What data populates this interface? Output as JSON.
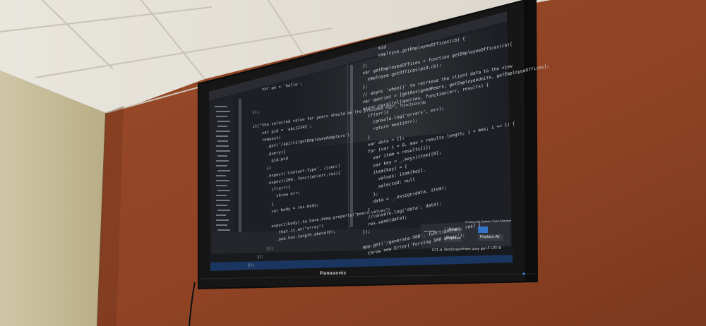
{
  "tv": {
    "brand": "Panasonic"
  },
  "editor": {
    "left_code": [
      "        var po = 'hello';",
      "",
      "        ",
      "    });",
      "",
      "    it(\"the selected value for peers should be the provided PID\", function(do",
      "        var pid = 'abc12345';",
      "        request(",
      "          .get('/api/v1/getEmployeeAdapters')",
      "          .query({",
      "            pid:pid",
      "          })",
      "          .expect('Content-Type', /json/)",
      "          .expect(200, function(err,res){",
      "            if(err){",
      "              throw err;",
      "            }",
      "            var body = res.body;",
      "",
      "            expect(body).to.have.deep.property(\"peers.values\")",
      "              .that.is.an(\"array\")",
      "              .and.has.length.above(0);",
      "          });",
      "      });",
      "  });"
    ],
    "right_code": [
      "        mid",
      "        employee.getEmployeeOffices(cb) {",
      "  };",
      "  var getEmployeeOffices = function getEmployeeOffices(cb){",
      "    employee.getOffices(pid,cb);",
      "  };",
      "  // async 'when()' to retrieve the client data to the view",
      "  var queries = [getAssignedPeers, getEmployeeUnits, getEmployeeOffices];",
      "  async.parallel(queries, function(err, results) {",
      "    if(err){",
      "      console.log('errors', err);",
      "      return next(err);",
      "    }",
      "    var data = {};",
      "    for (var i = 0, max = results.length; i < max; i += 1) {",
      "      var item = results[i];",
      "      var key = _.keys(item)[0];",
      "      item[key] = {",
      "        values: item[key],",
      "        selected: null",
      "      };",
      "      data = _.assign(data, item);",
      "    }",
      "    //console.log('data', data);",
      "    res.send(data);",
      "  });",
      "",
      "  app.get('/generate-500', function(req, res) {",
      "    throw new Error('Forcing 500 error');"
    ],
    "find_panel": {
      "header": "Finding with Options: Case Sensitive",
      "results": "no results",
      "find_label": "Find",
      "replace_label": "Replace",
      "replace_all_label": "Replace All"
    },
    "status_bar": {
      "encoding": "UTF-8",
      "language": "JavaScript",
      "branch": "simper puny plo",
      "line_ending": "LF UTF-8"
    }
  }
}
